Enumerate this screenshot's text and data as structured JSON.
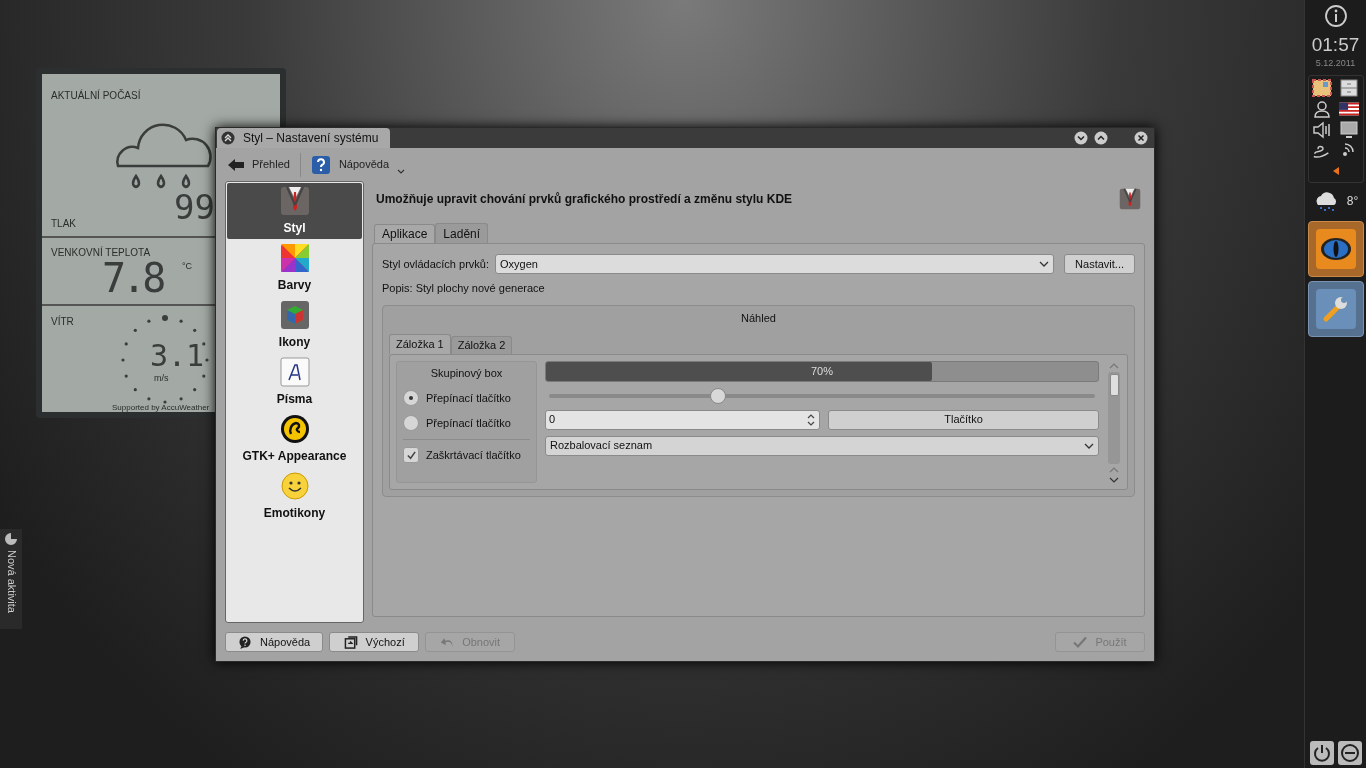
{
  "desktop": {
    "activity_tab": "Nová aktivita"
  },
  "weather_widget": {
    "title": "AKTUÁLNÍ POČASÍ",
    "pressure_label": "TLAK",
    "pressure_value": "99",
    "temperature_label": "VENKOVNÍ TEPLOTA",
    "temperature_value": "7.8",
    "temperature_unit": "°C",
    "wind_label": "VÍTR",
    "wind_value": "3.1",
    "wind_unit": "m/s",
    "credit": "Supported by AccuWeather"
  },
  "window": {
    "title": "Styl – Nastavení systému"
  },
  "toolbar": [
    {
      "kind": "back",
      "label": "Přehled"
    },
    {
      "kind": "help",
      "label": "Nápověda"
    }
  ],
  "sidebar": {
    "items": [
      {
        "kind": "suit",
        "label": "Styl",
        "selected": true
      },
      {
        "kind": "colors",
        "label": "Barvy",
        "selected": false
      },
      {
        "kind": "cube",
        "label": "Ikony",
        "selected": false
      },
      {
        "kind": "font",
        "label": "Písma",
        "selected": false
      },
      {
        "kind": "gtk",
        "label": "GTK+ Appearance",
        "selected": false
      },
      {
        "kind": "smiley",
        "label": "Emotikony",
        "selected": false
      }
    ]
  },
  "header": "Umožňuje upravit chování prvků grafického prostředí a změnu stylu KDE",
  "tabs": [
    {
      "label": "Aplikace",
      "selected": true
    },
    {
      "label": "Ladění",
      "selected": false
    }
  ],
  "widget_style": {
    "label": "Styl ovládacích prvků:",
    "value": "Oxygen",
    "button": "Nastavit..."
  },
  "description": "Popis: Styl plochy nové generace",
  "preview": {
    "title": "Náhled",
    "tabs": [
      {
        "label": "Záložka 1",
        "selected": true
      },
      {
        "label": "Záložka 2",
        "selected": false
      }
    ],
    "group_title": "Skupinový box",
    "radios": [
      {
        "label": "Přepínací tlačítko",
        "selected": true
      },
      {
        "label": "Přepínací tlačítko",
        "selected": false
      }
    ],
    "checkbox": {
      "label": "Zaškrtávací tlačítko",
      "checked": true
    },
    "progress": {
      "level": 0.7,
      "reading": "70%"
    },
    "slider": {
      "level": 0.31
    },
    "spin_value": "0",
    "button": "Tlačítko",
    "combo": "Rozbalovací seznam"
  },
  "buttons": [
    {
      "kind": "help",
      "label": "Nápověda",
      "disabled": false
    },
    {
      "kind": "defaults",
      "label": "Výchozí",
      "disabled": false
    },
    {
      "kind": "reset",
      "label": "Obnovit",
      "disabled": true
    },
    {
      "kind": "apply",
      "label": "Použít",
      "disabled": true
    }
  ],
  "panel": {
    "time": "01:57",
    "date": "5.12.2011",
    "weather_temp": "8°"
  }
}
